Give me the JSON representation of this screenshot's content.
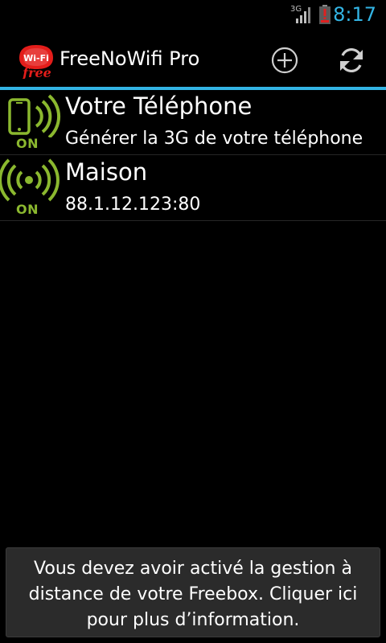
{
  "status_bar": {
    "network_type": "3G",
    "time": "8:17",
    "icons": [
      "signal-icon",
      "battery-alert-icon"
    ]
  },
  "action_bar": {
    "logo_text_top": "Wi-Fi",
    "logo_text_bottom": "free",
    "title": "FreeNoWifi Pro",
    "actions": [
      "add-icon",
      "refresh-icon"
    ]
  },
  "connections": [
    {
      "title": "Votre Téléphone",
      "subtitle": "Générer la 3G de votre téléphone",
      "status": "ON",
      "icon": "phone-signal-icon"
    },
    {
      "title": "Maison",
      "subtitle": "88.1.12.123:80",
      "status": "ON",
      "icon": "wifi-broadcast-icon"
    }
  ],
  "toast": {
    "message": "Vous devez avoir activé la gestion à distance de votre Freebox. Cliquer ici pour plus d’information."
  },
  "colors": {
    "accent": "#33b5e5",
    "status_on": "#8bb82f",
    "alert": "#e02020",
    "background": "#000000",
    "toast_background": "#2b2b2b"
  }
}
